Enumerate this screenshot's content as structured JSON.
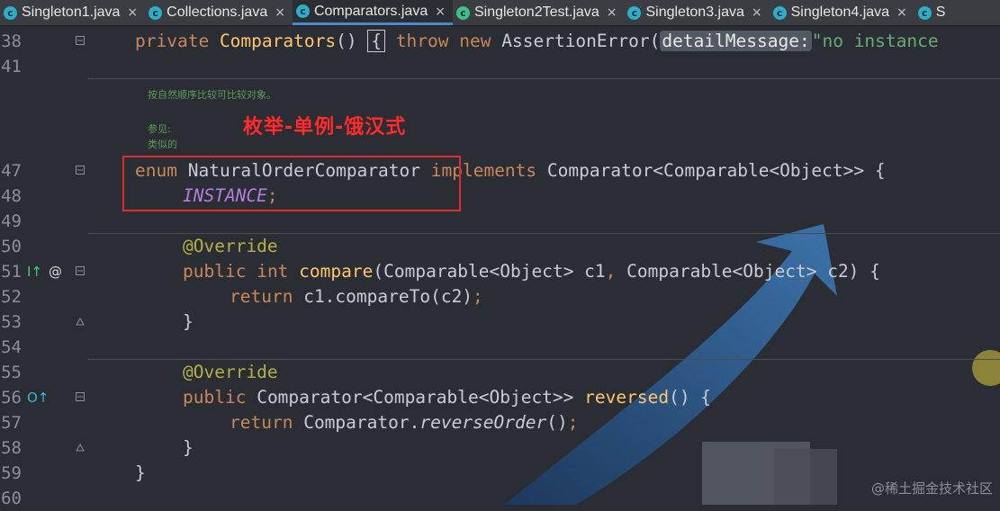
{
  "tabs": [
    {
      "label": "Singleton1.java",
      "icon": "class-icon",
      "active": false
    },
    {
      "label": "Collections.java",
      "icon": "class-icon",
      "active": false
    },
    {
      "label": "Comparators.java",
      "icon": "class-icon",
      "active": true
    },
    {
      "label": "Singleton2Test.java",
      "icon": "test-class-icon",
      "active": false
    },
    {
      "label": "Singleton3.java",
      "icon": "class-icon",
      "active": false
    },
    {
      "label": "Singleton4.java",
      "icon": "class-icon",
      "active": false
    },
    {
      "label": "S",
      "icon": "class-icon",
      "active": false
    }
  ],
  "tab_close_glyph": "×",
  "tab_icon_letter": "c",
  "line_numbers": {
    "l38": "38",
    "l41": "41",
    "l47": "47",
    "l48": "48",
    "l49": "49",
    "l50": "50",
    "l51": "51",
    "l52": "52",
    "l53": "53",
    "l54": "54",
    "l55": "55",
    "l56": "56",
    "l57": "57",
    "l58": "58",
    "l59": "59",
    "l60": "60"
  },
  "code": {
    "l38": {
      "kw_private": "private",
      "ctor": "Comparators",
      "parens": "()",
      "brace": "{",
      "kw_throw": "throw",
      "kw_new": "new",
      "cls": "AssertionError(",
      "hint": "detailMessage:",
      "str": "\"no instance"
    },
    "l47": {
      "kw_enum": "enum",
      "name": "NaturalOrderComparator",
      "kw_implements": "implements",
      "rest": "Comparator<Comparable<Object>> {"
    },
    "l48": {
      "constant": "INSTANCE",
      "semi": ";"
    },
    "l50": {
      "ann": "@Override"
    },
    "l51": {
      "kw_public": "public",
      "kw_int": "int",
      "fn": "compare",
      "params_a": "(Comparable<Object> c1",
      "comma": ",",
      "params_b": " Comparable<Object> c2) {"
    },
    "l52": {
      "kw_return": "return",
      "expr": "c1.compareTo(c2)",
      "semi": ";"
    },
    "l53": {
      "brace": "}"
    },
    "l55": {
      "ann": "@Override"
    },
    "l56": {
      "kw_public": "public",
      "type": "Comparator<Comparable<Object>>",
      "fn": "reversed",
      "rest": "() {"
    },
    "l57": {
      "kw_return": "return",
      "cls": "Comparator.",
      "method": "reverseOrder",
      "rest": "()",
      "semi": ";"
    },
    "l58": {
      "brace": "}"
    },
    "l59": {
      "brace": "}"
    }
  },
  "doc_comment": {
    "line1": "按自然顺序比较可比较对象。",
    "line2": "参见:",
    "line3": "类似的"
  },
  "gutter_marks": {
    "l51_impl": "I↑",
    "l51_at": "@",
    "l56_override": "O↑"
  },
  "overlay": {
    "red_title": "枚举-单例-饿汉式",
    "watermark": "@稀土掘金技术社区"
  },
  "colors": {
    "background": "#2a2d33",
    "keyword": "#c9885a",
    "function": "#ffc66d",
    "constant": "#b57ede",
    "annotation": "#b5b045",
    "string": "#6aab73",
    "doc_comment": "#5e9c5e",
    "highlight_box": "#e12a2a",
    "tab_active_underline": "#4a88c7"
  }
}
